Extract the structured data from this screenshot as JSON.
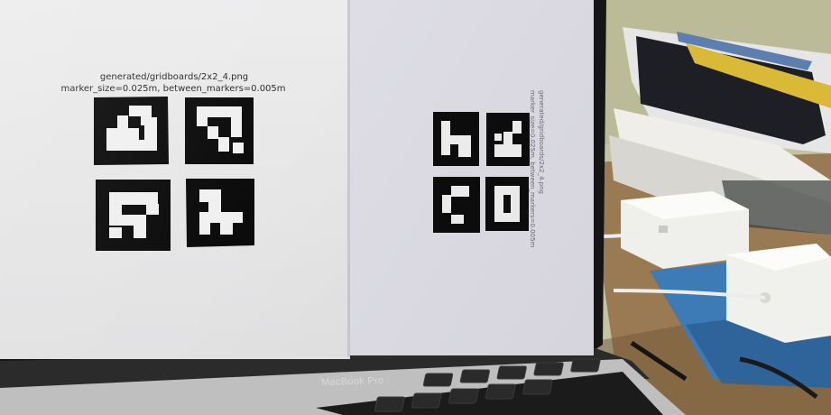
{
  "screen_left": {
    "caption_line1": "generated/gridboards/2x2_4.png",
    "caption_line2": "marker_size=0.025m, between_markers=0.005m"
  },
  "screen_right": {
    "caption_line1": "generated/gridboards/2x2_4.png",
    "caption_line2": "marker_size=0.025m, between_markers=0.005m"
  },
  "laptop": {
    "brand_label": "MacBook Pro"
  },
  "colors": {
    "screen_left": "#e9e9ea",
    "screen_right": "#dedde6",
    "bezel": "#151515",
    "keyboard": "#1b1b1b",
    "marker": "#0c0c0c",
    "desk": "#9a7a52",
    "wall": "#c7c6a7"
  }
}
